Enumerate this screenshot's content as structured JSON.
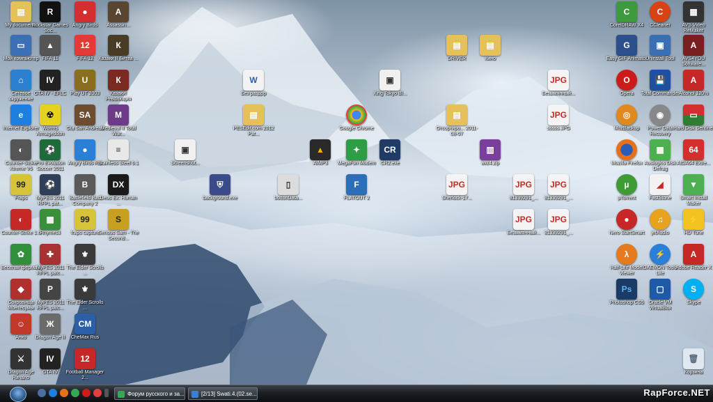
{
  "desktop": {
    "icons": {
      "my_documents": "My documents",
      "rockstar": "Rockstar Games Soc...",
      "angry_birds": "Angry Birds",
      "assassin": "Assassin...",
      "my_computer": "Мой компьютер",
      "fifa11": "FIFA 11",
      "fifa12": "FIFA 12",
      "kazaki": "Казаки II Битва ...",
      "network": "Сетевое окружение",
      "gta_efl": "GTA IV - EFLC",
      "play_ut": "Play UT 2003",
      "kazaki_rev": "Казаки! Революция",
      "ie": "Internet Explorer",
      "worms": "Worms Armageddon",
      "gta_sa": "Gta San Andreas",
      "medieval": "Medieval II Total War...",
      "cs_xtreme": "Counter-Strike Xtreme V5",
      "pes2011": "Pro Evolution Soccer 2011",
      "angry_rio": "Angry Birds Rio",
      "stainless": "Stainless Steel 6.1",
      "fraps": "Fraps",
      "mypes_1": "MyPES 2011 RFPL pat...",
      "bf_bc2": "Battlefield Bad Company 2",
      "dx_human": "Deus Ex: Human ...",
      "cs16": "Counter-Strike 1.6",
      "rhymes": "Rhymes3",
      "fraps_capture": "fraps capture",
      "serious_sam": "Serious Sam - The Second...",
      "veselaya": "Веселая ферма 2",
      "mypes_2": "MyPES 2011 RFPL patc...",
      "elder_1": "The Elder Scrolls ...",
      "sokrovisha": "Сокровища Монтесумы",
      "mypes_3": "MyPES 2011 RFPL patc...",
      "elder_2": "The Elder Scrolls ...",
      "anko": "Анко",
      "dragon_age2": "Dragon Age II",
      "cheemax": "CheMax Rus",
      "dragon_age_nach": "Dragon Age Начало",
      "gta4": "GTA IV",
      "fm2": "Football Manager 2...",
      "bes_razdor": "Без раздор",
      "pesedit": "PESEdit.com 2012 Pat...",
      "screenshot_c": "Screenshot...",
      "aimp3": "AIMP3",
      "background": "background.exe",
      "bottondata": "bottonData...",
      "xing": "Xing Tokyo Bl...",
      "chrome": "Google Chrome",
      "megafon": "MegaFon Modem",
      "cr2": "CR2.exe",
      "flatout": "FLATOUT 2",
      "drivers": "DRIVER",
      "kino": "Кино",
      "otsortirovano": "Отсортиро... 2011-08-07",
      "avz": "avz4.zip",
      "sherlock": "Sherlock-17...",
      "jpg_1": "Безымянный...",
      "jpg_2": "sssss.JPG",
      "jpg_3": "81339291_...",
      "jpg_4": "Безымянный...",
      "jpg_5": "81339291_...",
      "jpg_6": "81339291_...",
      "coreldraw": "CorelDRAW X4",
      "ccleaner": "CCleaner",
      "avs_video": "AVS Video ReMaker",
      "easy_gif": "Easy GIF Animator",
      "uninstall": "Uninstall Tool",
      "avs_audio": "AVS4YOU Software...",
      "opera": "Opera",
      "total_commander": "Total Commander",
      "alcohol": "Alcohol 120%",
      "mozbackup": "MozBackup",
      "power_data": "Power Data Recovery",
      "hard_disk": "Hard Disk Sentinel",
      "firefox": "Mozilla Firefox",
      "auslogics": "Auslogics Disk Defrag",
      "aida64": "AIDA64 Extre...",
      "utorrent": "µTorrent",
      "faststone": "FastStone",
      "smart_install": "Smart Install Maker",
      "nero": "Nero StartSmart",
      "jetaudio": "jetAudio",
      "hd_tune": "HD Tune",
      "hlmv": "Half-Life Model Viewer",
      "daemon": "DAEMON Tools Lite",
      "adobe_reader": "Adobe Reader X",
      "photoshop": "Photoshop CS5",
      "vbox": "Oracle VM VirtualBox",
      "skype": "Skype",
      "recycle": "Корзина"
    }
  },
  "taskbar": {
    "task_1": "Форум русского и за...",
    "task_2": "[2/13] Swati.4.(02.se...",
    "watermark": "RapForce.NET"
  },
  "colors": {
    "taskbar": "#1c1f23",
    "label_text": "#ffffff"
  }
}
